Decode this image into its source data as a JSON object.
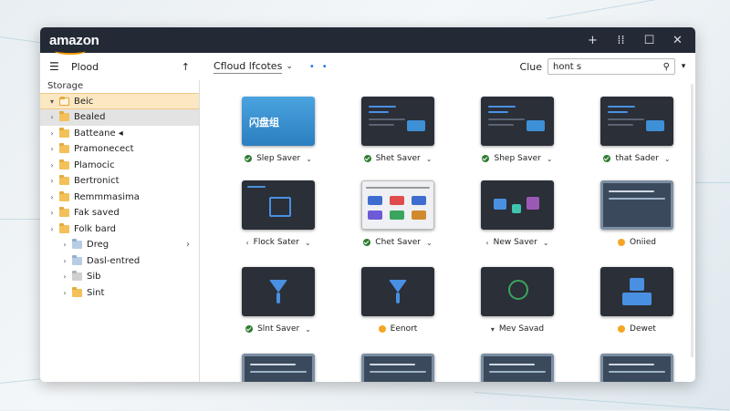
{
  "window": {
    "brand": "amazon",
    "controls": [
      "+",
      "⁞⁞",
      "☐",
      "✕"
    ]
  },
  "sidebar": {
    "header_label": "Plood",
    "storage_label": "Storage",
    "items": [
      {
        "label": "Beic",
        "state": "selected",
        "expander": "▾",
        "folder": "outline"
      },
      {
        "label": "Bealed",
        "state": "active",
        "expander": "›",
        "folder": "normal"
      },
      {
        "label": "Batteane ◂",
        "state": "",
        "expander": "›",
        "folder": "normal"
      },
      {
        "label": "Pramonecect",
        "state": "",
        "expander": "›",
        "folder": "normal"
      },
      {
        "label": "Plamocic",
        "state": "",
        "expander": "›",
        "folder": "normal"
      },
      {
        "label": "Bertronict",
        "state": "",
        "expander": "›",
        "folder": "normal"
      },
      {
        "label": "Remmmasima",
        "state": "",
        "expander": "›",
        "folder": "normal"
      },
      {
        "label": "Fak saved",
        "state": "",
        "expander": "›",
        "folder": "normal"
      },
      {
        "label": "Folk bard",
        "state": "",
        "expander": "›",
        "folder": "normal"
      },
      {
        "label": "Dreg",
        "state": "",
        "expander": "›",
        "folder": "blue",
        "chevron": "›",
        "indent": true
      },
      {
        "label": "Dasl-entred",
        "state": "",
        "expander": "›",
        "folder": "blue",
        "indent": true
      },
      {
        "label": "Sib",
        "state": "",
        "expander": "›",
        "folder": "grey",
        "indent": true
      },
      {
        "label": "Sint",
        "state": "",
        "expander": "›",
        "folder": "normal",
        "indent": true
      }
    ]
  },
  "toolbar": {
    "breadcrumb": "Cfloud lfcotes",
    "search_label": "Clue",
    "search_value": "hont s"
  },
  "grid": {
    "tiles": [
      {
        "caption": "Slep Saver",
        "icon": "check",
        "caret": true,
        "thumb": "blue",
        "thumb_text": "闪盘组"
      },
      {
        "caption": "Shet Saver",
        "icon": "check",
        "caret": true,
        "thumb": "dark-bars"
      },
      {
        "caption": "Shep Saver",
        "icon": "check",
        "caret": true,
        "thumb": "dark-bars"
      },
      {
        "caption": "that Sader",
        "icon": "check",
        "caret": true,
        "thumb": "dark-bars"
      },
      {
        "caption": "Flock Sater",
        "icon": "none",
        "pre": "‹",
        "caret": true,
        "thumb": "dark-chart"
      },
      {
        "caption": "Chet Saver",
        "icon": "check",
        "caret": true,
        "thumb": "paper"
      },
      {
        "caption": "New Saver",
        "icon": "none",
        "pre": "‹",
        "caret": true,
        "thumb": "dark-nodes"
      },
      {
        "caption": "Oniied",
        "icon": "orange-folder",
        "caret": false,
        "thumb": "frame"
      },
      {
        "caption": "Slnt Saver",
        "icon": "check",
        "caret": true,
        "thumb": "dark-hourglass"
      },
      {
        "caption": "Eenort",
        "icon": "orange",
        "caret": false,
        "thumb": "dark-hourglass"
      },
      {
        "caption": "Mev Savad",
        "icon": "none",
        "pre": "▾",
        "caret": false,
        "thumb": "dark-circle"
      },
      {
        "caption": "Dewet",
        "icon": "orange",
        "caret": false,
        "thumb": "dark-user"
      },
      {
        "caption": "",
        "icon": "none",
        "caret": false,
        "thumb": "frame"
      },
      {
        "caption": "",
        "icon": "none",
        "caret": false,
        "thumb": "frame"
      },
      {
        "caption": "",
        "icon": "none",
        "caret": false,
        "thumb": "frame"
      },
      {
        "caption": "",
        "icon": "none",
        "caret": false,
        "thumb": "frame"
      }
    ]
  },
  "colors": {
    "titlebar": "#232a36",
    "selection": "#fbe7c2",
    "accent": "#1a73e8",
    "brand_smile": "#ff9900"
  }
}
